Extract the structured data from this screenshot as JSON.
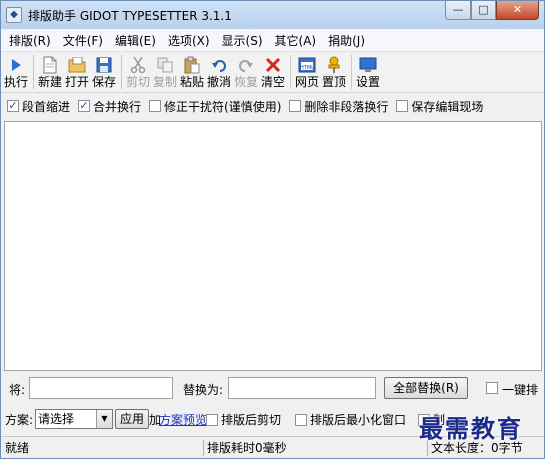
{
  "window": {
    "title": "排版助手 GIDOT TYPESETTER 3.1.1",
    "controls": {
      "minimize": "—",
      "maximize": "□",
      "close": "✕"
    }
  },
  "menu": [
    {
      "label": "排版(R)"
    },
    {
      "label": "文件(F)"
    },
    {
      "label": "编辑(E)"
    },
    {
      "label": "选项(X)"
    },
    {
      "label": "显示(S)"
    },
    {
      "label": "其它(A)"
    },
    {
      "label": "捐助(J)"
    }
  ],
  "toolbar": {
    "run": "执行",
    "new": "新建",
    "open": "打开",
    "save": "保存",
    "cut": "剪切",
    "copy": "复制",
    "paste": "粘贴",
    "undo": "撤消",
    "redo": "恢复",
    "clear": "清空",
    "web": "网页",
    "top": "置顶",
    "settings": "设置"
  },
  "options": [
    {
      "label": "段首缩进",
      "checked": true
    },
    {
      "label": "合并换行",
      "checked": true
    },
    {
      "label": "修正干扰符(谨慎使用)",
      "checked": false
    },
    {
      "label": "删除非段落换行",
      "checked": false
    },
    {
      "label": "保存编辑现场",
      "checked": false
    }
  ],
  "editor": {
    "content": ""
  },
  "replace": {
    "find_label": "将:",
    "find_value": "",
    "replace_label": "替换为:",
    "replace_value": "",
    "replace_all_button": "全部替换(R)",
    "one_click_label": "一键排"
  },
  "scheme": {
    "label": "方案:",
    "selected": "请选择",
    "apply_button": "应用",
    "preview_link_prefix": "加",
    "preview_link": "方案预览",
    "cut_after_label": "排版后剪切",
    "minimize_after_label": "排版后最小化窗口",
    "extra_label": "制"
  },
  "status": {
    "state": "就绪",
    "elapsed": "排版耗时0毫秒",
    "text_length": "文本长度：0字节"
  },
  "watermark": "最需教育",
  "colors": {
    "link": "#1a35c8",
    "titlebar": "#cfe1f5",
    "close": "#c3472a"
  }
}
